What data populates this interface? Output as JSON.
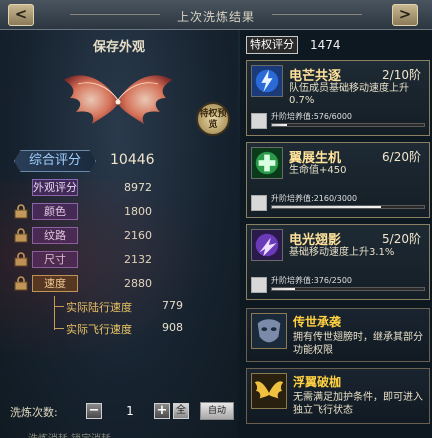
{
  "header": {
    "title": "上次洗炼结果",
    "prev_icon": "chevron-left-icon",
    "next_icon": "chevron-right-icon",
    "prev_label": "<",
    "next_label": ">"
  },
  "left": {
    "preview_title": "保存外观",
    "badge_text": "特权预览",
    "score_label": "综合评分",
    "score_value": "10446",
    "attributes": [
      {
        "label": "外观评分",
        "value": "8972",
        "locked": false
      },
      {
        "label": "颜色",
        "value": "1800",
        "locked": true
      },
      {
        "label": "纹路",
        "value": "2160",
        "locked": true
      },
      {
        "label": "尺寸",
        "value": "2132",
        "locked": true
      },
      {
        "label": "速度",
        "value": "2880",
        "locked": true
      }
    ],
    "sub_attributes": [
      {
        "label": "实际陆行速度",
        "value": "779"
      },
      {
        "label": "实际飞行速度",
        "value": "908"
      }
    ],
    "wash_count_label": "洗炼次数:",
    "wash_count_value": "1",
    "minus_label": "−",
    "plus_label": "+",
    "all_label": "全",
    "auto_label": "自动",
    "cut_text": "洗炼消耗    锁定消耗"
  },
  "right": {
    "priv_label": "特权评分",
    "priv_value": "1474",
    "skills": [
      {
        "name": "电芒共逐",
        "level": "2/10阶",
        "desc": "队伍成员基础移动速度上升0.7%",
        "progress_label": "升阶培养值:576/6000",
        "progress": 0.096,
        "icon": "lightning-icon"
      },
      {
        "name": "翼展生机",
        "level": "6/20阶",
        "desc": "生命值+450",
        "progress_label": "升阶培养值:2160/3000",
        "progress": 0.72,
        "icon": "cross-icon"
      },
      {
        "name": "电光翅影",
        "level": "5/20阶",
        "desc": "基础移动速度上升3.1%",
        "progress_label": "升阶培养值:376/2500",
        "progress": 0.15,
        "icon": "spark-icon"
      }
    ],
    "inherits": [
      {
        "name": "传世承袭",
        "desc": "拥有传世翅膀时，继承其部分功能权限",
        "icon": "mask-icon"
      },
      {
        "name": "浮翼破枷",
        "desc": "无需满足加护条件，即可进入独立飞行状态",
        "icon": "golden-wing-icon"
      }
    ]
  },
  "colors": {
    "accent_gold": "#ffe29a",
    "score_blue": "#9ed0ff",
    "tag_purple": "#3a2a5a"
  }
}
